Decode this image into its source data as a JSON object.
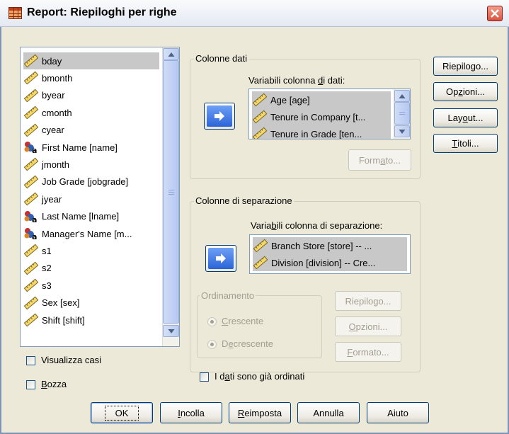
{
  "window": {
    "title": "Report: Riepiloghi per righe"
  },
  "source_list": {
    "items": [
      {
        "label": "bday",
        "icon": "ruler-icon",
        "selected": true
      },
      {
        "label": "bmonth",
        "icon": "ruler-icon"
      },
      {
        "label": "byear",
        "icon": "ruler-icon"
      },
      {
        "label": "cmonth",
        "icon": "ruler-icon"
      },
      {
        "label": "cyear",
        "icon": "ruler-icon"
      },
      {
        "label": "First Name [name]",
        "icon": "string-variable-icon"
      },
      {
        "label": "jmonth",
        "icon": "ruler-icon"
      },
      {
        "label": "Job Grade [jobgrade]",
        "icon": "ruler-icon"
      },
      {
        "label": "jyear",
        "icon": "ruler-icon"
      },
      {
        "label": "Last Name [lname]",
        "icon": "string-variable-icon"
      },
      {
        "label": "Manager's Name [m...",
        "icon": "string-variable-icon"
      },
      {
        "label": "s1",
        "icon": "ruler-icon"
      },
      {
        "label": "s2",
        "icon": "ruler-icon"
      },
      {
        "label": "s3",
        "icon": "ruler-icon"
      },
      {
        "label": "Sex [sex]",
        "icon": "ruler-icon"
      },
      {
        "label": "Shift [shift]",
        "icon": "ruler-icon"
      }
    ]
  },
  "checkboxes": {
    "visualizza_casi": {
      "pre": "Visualizza casi",
      "checked": false
    },
    "bozza": {
      "pre": "",
      "key": "B",
      "post": "ozza",
      "checked": false
    },
    "ordinati": {
      "pre": "I d",
      "key": "a",
      "post": "ti sono già ordinati",
      "checked": false
    }
  },
  "colonne_dati": {
    "legend": "Colonne dati",
    "list_label": {
      "pre": "Variabili colonna ",
      "key": "d",
      "post": "i dati:"
    },
    "items": [
      {
        "label": "Age [age]",
        "icon": "ruler-icon"
      },
      {
        "label": "Tenure in Company [t...",
        "icon": "ruler-icon"
      },
      {
        "label": "Tenure in Grade [ten...",
        "icon": "ruler-icon"
      }
    ],
    "formato": {
      "pre": "Form",
      "key": "a",
      "post": "to..."
    }
  },
  "colonne_separazione": {
    "legend": "Colonne di separazione",
    "list_label": {
      "pre": "Varia",
      "key": "b",
      "post": "ili colonna di separazione:"
    },
    "items": [
      {
        "label": "Branch Store [store] -- ...",
        "icon": "ruler-icon"
      },
      {
        "label": "Division [division] -- Cre...",
        "icon": "ruler-icon"
      }
    ]
  },
  "ordinamento": {
    "legend": "Ordinamento",
    "crescente": {
      "key": "C",
      "post": "rescente",
      "selected": true
    },
    "decrescente": {
      "pre": "D",
      "key": "e",
      "post": "crescente",
      "selected": false
    },
    "riepilogo": {
      "pre": "Riepilo",
      "key": "g",
      "post": "o..."
    },
    "opzioni": {
      "key": "O",
      "post": "pzioni..."
    },
    "formato": {
      "key": "F",
      "post": "ormato..."
    }
  },
  "side_buttons": {
    "riepilogo": {
      "pre": "Riepilo",
      "key": "g",
      "post": "o..."
    },
    "opzioni": {
      "pre": "Op",
      "key": "z",
      "post": "ioni..."
    },
    "layout": {
      "pre": "Lay",
      "key": "o",
      "post": "ut..."
    },
    "titoli": {
      "key": "T",
      "post": "itoli..."
    }
  },
  "bottom_buttons": {
    "ok": {
      "label": "OK"
    },
    "incolla": {
      "key": "I",
      "post": "ncolla"
    },
    "reimposta": {
      "key": "R",
      "post": "eimposta"
    },
    "annulla": {
      "label": "Annulla"
    },
    "aiuto": {
      "label": "Aiuto"
    }
  },
  "colors": {
    "titlebar": "#E3E8F2",
    "dialog_bg": "#ECE9D8",
    "selection": "#C8C8C8",
    "accent_blue": "#2A64D8"
  }
}
